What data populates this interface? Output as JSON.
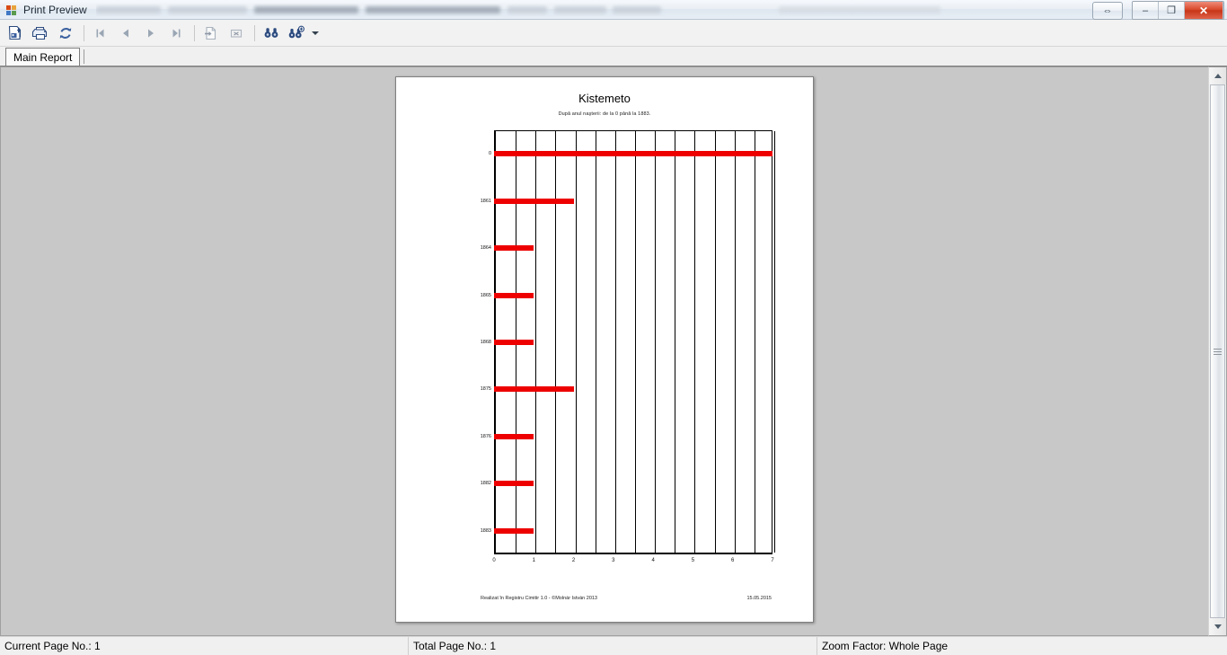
{
  "window": {
    "title": "Print Preview",
    "icon": "app-icon",
    "buttons": {
      "help_label": "⇔",
      "minimize_label": "–",
      "restore_label": "❐",
      "close_label": "✕"
    }
  },
  "toolbar": {
    "items": [
      {
        "name": "export-icon",
        "tip": "Export Report"
      },
      {
        "name": "print-icon",
        "tip": "Print Report"
      },
      {
        "name": "refresh-icon",
        "tip": "Refresh"
      },
      {
        "name": "first-page-icon",
        "tip": "Go To First Page"
      },
      {
        "name": "previous-page-icon",
        "tip": "Go To Previous Page"
      },
      {
        "name": "next-page-icon",
        "tip": "Go To Next Page"
      },
      {
        "name": "last-page-icon",
        "tip": "Go To Last Page"
      },
      {
        "name": "go-to-page-icon",
        "tip": "Go To Page"
      },
      {
        "name": "stop-icon",
        "tip": "Close Current View"
      },
      {
        "name": "search-icon",
        "tip": "Find Text"
      },
      {
        "name": "zoom-icon",
        "tip": "Zoom"
      }
    ]
  },
  "tabs": {
    "items": [
      {
        "label": "Main Report",
        "selected": true
      }
    ]
  },
  "report": {
    "title": "Kistemeto",
    "subtitle": "După anul naşterii: de la 0 până la 1883.",
    "footer_left": "Realizat în Registru Cimitir 1.0 - ©Molnár István 2013",
    "footer_right": "15.05.2015"
  },
  "chart_data": {
    "type": "bar",
    "orientation": "horizontal",
    "title": "Kistemeto",
    "subtitle": "După anul naşterii: de la 0 până la 1883.",
    "xlabel": "",
    "ylabel": "",
    "categories": [
      "0",
      "1861",
      "1864",
      "1865",
      "1868",
      "1875",
      "1876",
      "1882",
      "1883"
    ],
    "values": [
      7,
      2,
      1,
      1,
      1,
      2,
      1,
      1,
      1
    ],
    "xticks": [
      "0",
      "1",
      "2",
      "3",
      "4",
      "5",
      "6",
      "7"
    ],
    "xlim": [
      0,
      7
    ],
    "xtick_step": 1,
    "minor_gridline_step": 0.5,
    "grid": true,
    "grid_axis": "x",
    "legend": false,
    "bar_color": "#ee0000",
    "axis_color": "#000000"
  },
  "scrollbar": {
    "up_label": "▲",
    "down_label": "▼"
  },
  "statusbar": {
    "current_page": "Current Page No.: 1",
    "total_page": "Total Page No.: 1",
    "zoom_factor": "Zoom Factor: Whole Page"
  }
}
